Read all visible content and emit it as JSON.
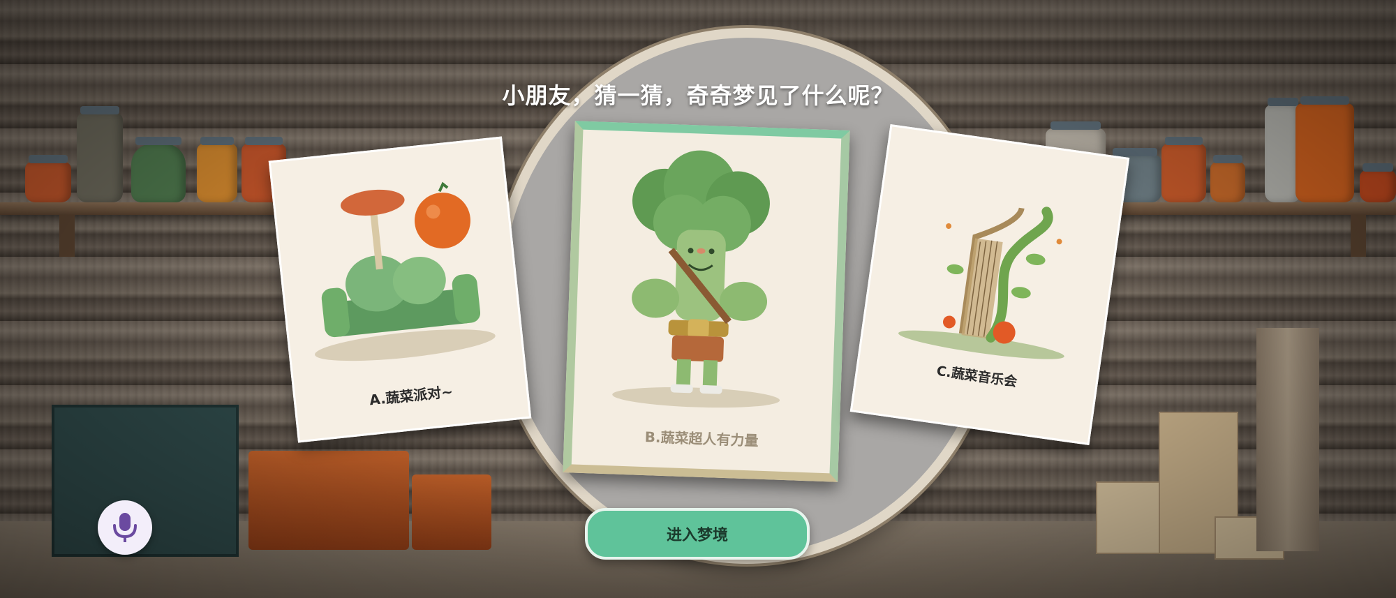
{
  "title": "小朋友，猜一猜，奇奇梦见了什么呢？",
  "cards": [
    {
      "label": "A.蔬菜派对~",
      "illustration": "vegetable-party-sofa"
    },
    {
      "label": "B.蔬菜超人有力量",
      "illustration": "broccoli-superhero"
    },
    {
      "label": "C.蔬菜音乐会",
      "illustration": "bean-vine-harp"
    }
  ],
  "buttons": {
    "enter_label": "进入梦境",
    "mic_icon": "microphone-icon"
  },
  "colors": {
    "accent_green": "#5fc39a",
    "mic_purple": "#6b4aa0"
  }
}
